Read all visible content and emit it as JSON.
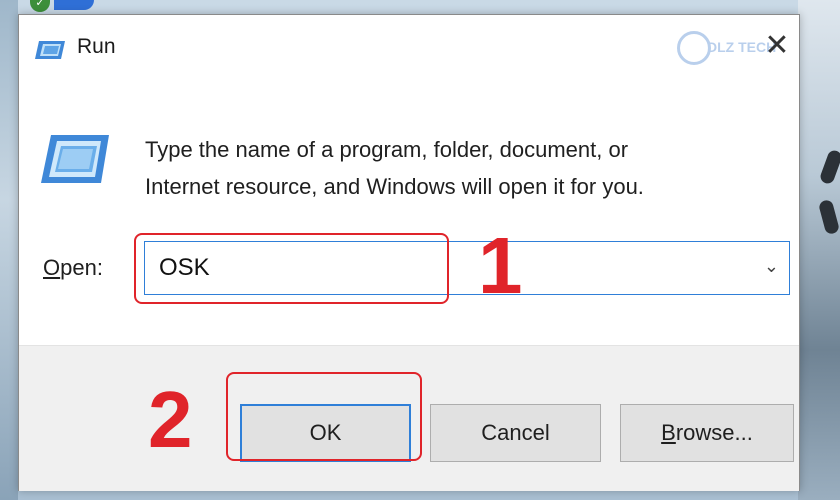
{
  "window": {
    "title": "Run",
    "close_glyph": "✕",
    "watermark": "DLZ TECH"
  },
  "dialog": {
    "description_line1": "Type the name of a program, folder, document, or",
    "description_line2": "Internet resource, and Windows will open it for you.",
    "open_label_underlined": "O",
    "open_label_rest": "pen:",
    "open_value": "OSK",
    "dropdown_glyph": "⌄"
  },
  "buttons": {
    "ok": "OK",
    "cancel": "Cancel",
    "browse_underlined": "B",
    "browse_rest": "rowse..."
  },
  "annotations": {
    "step1": "1",
    "step2": "2"
  },
  "icons": {
    "title": "run-icon",
    "main": "run-large-icon",
    "close": "close-icon",
    "dropdown": "chevron-down-icon"
  },
  "colors": {
    "accent_border": "#2f7fd8",
    "annotation_red": "#e0242a",
    "footer_bg": "#f0f0f0",
    "button_bg": "#e1e1e1"
  }
}
